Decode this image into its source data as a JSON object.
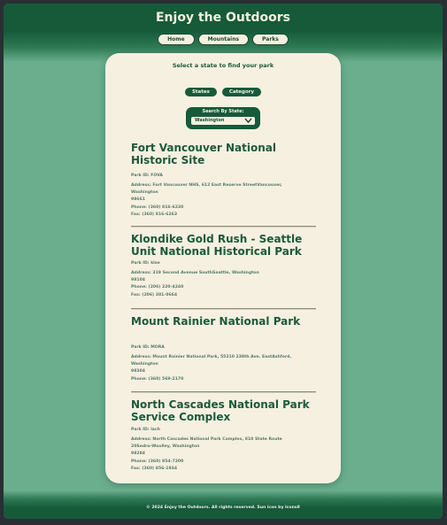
{
  "header": {
    "title": "Enjoy the Outdoors",
    "nav": [
      "Home",
      "Mountains",
      "Parks"
    ]
  },
  "main": {
    "intro": "Select a state to find your park",
    "filters": [
      "States",
      "Category"
    ],
    "search": {
      "label": "Search By State:",
      "selected": "Washington"
    },
    "parks": [
      {
        "name_line1": "Fort Vancouver National",
        "name_line2": "Historic Site",
        "id": "Park ID: FOVA",
        "address_line1": "Address: Fort Vancouver NHS, 612 East Reserve StreetVancouver,",
        "address_line2": "Washington",
        "zip": "98661",
        "phone": "Phone: (360) 816-6230",
        "fax": "Fax: (360) 816-6263"
      },
      {
        "name_line1": "Klondike Gold Rush - Seattle",
        "name_line2": "Unit National Historical Park",
        "id": "Park ID: klse",
        "address_line1": "Address: 319 Second Avenue SouthSeattle, Washington",
        "address_line2": "",
        "zip": "98104",
        "phone": "Phone: (206) 220-4240",
        "fax": "Fax: (206) 381-0664"
      },
      {
        "name_line1": "Mount Rainier National Park",
        "name_line2": "",
        "id": "Park ID: MORA",
        "address_line1": "Address: Mount Rainier National Park, 55210 238th Ave. EastAshford,",
        "address_line2": "Washington",
        "zip": "98304",
        "phone": "Phone: (360) 569-2170",
        "fax": ""
      },
      {
        "name_line1": "North Cascades National Park",
        "name_line2": "Service Complex",
        "id": "Park ID: lach",
        "address_line1": "Address: North Cascades National Park Complex, 810 State Route",
        "address_line2": "20Sedro-Woolley, Washington",
        "zip": "98284",
        "phone": "Phone: (360) 854-7200",
        "fax": "Fax: (360) 856-1934"
      }
    ]
  },
  "footer": {
    "text": "© 2024 Enjoy the Outdoors. All rights reserved. Sun icon by Icons8"
  },
  "colors": {
    "background": "#6aae8e",
    "dark_green": "#165a3a",
    "cream": "#f6f0e1"
  }
}
